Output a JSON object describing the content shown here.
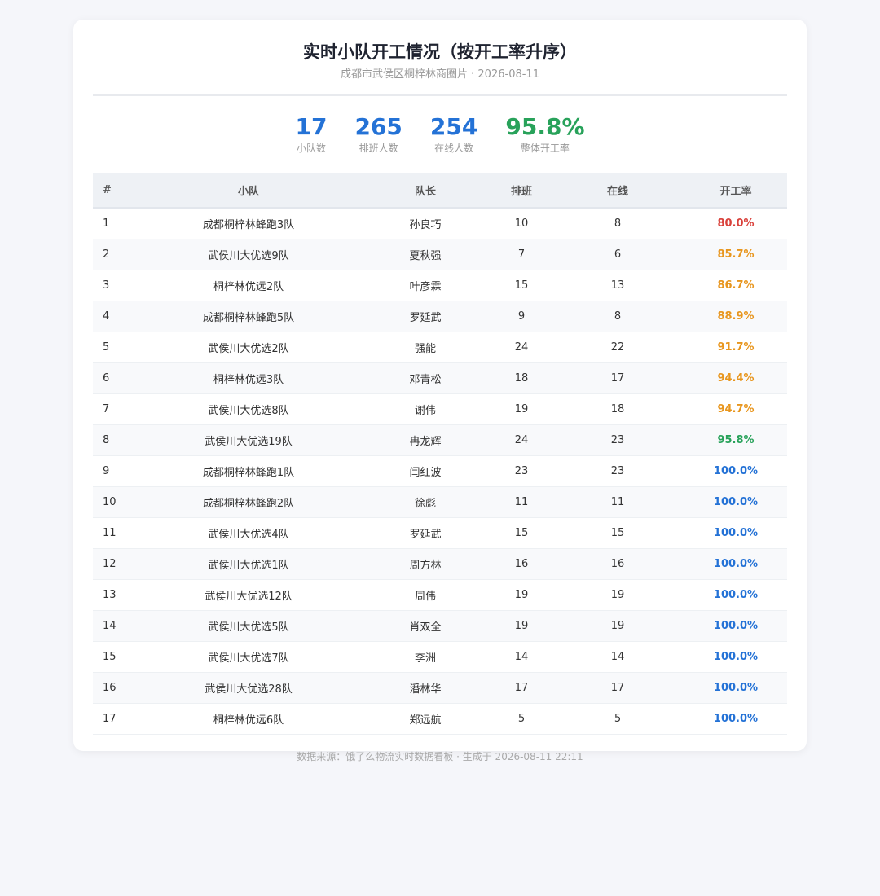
{
  "header": {
    "title": "实时小队开工情况（按开工率升序）",
    "subtitle": "成都市武侯区桐梓林商圈片 · 2026-08-11"
  },
  "stats": [
    {
      "value": "17",
      "label": "小队数",
      "color": "#2472d6"
    },
    {
      "value": "265",
      "label": "排班人数",
      "color": "#2472d6"
    },
    {
      "value": "254",
      "label": "在线人数",
      "color": "#2472d6"
    },
    {
      "value": "95.8%",
      "label": "整体开工率",
      "color": "#28a25a"
    }
  ],
  "table": {
    "headers": [
      "#",
      "小队",
      "队长",
      "排班",
      "在线",
      "开工率"
    ],
    "rows": [
      {
        "idx": "1",
        "team": "成都桐梓林蜂跑3队",
        "leader": "孙良巧",
        "scheduled": "10",
        "online": "8",
        "rate": "80.0%",
        "rate_color": "#d9413b"
      },
      {
        "idx": "2",
        "team": "武侯川大优选9队",
        "leader": "夏秋强",
        "scheduled": "7",
        "online": "6",
        "rate": "85.7%",
        "rate_color": "#e8961e"
      },
      {
        "idx": "3",
        "team": "桐梓林优远2队",
        "leader": "叶彦霖",
        "scheduled": "15",
        "online": "13",
        "rate": "86.7%",
        "rate_color": "#e8961e"
      },
      {
        "idx": "4",
        "team": "成都桐梓林蜂跑5队",
        "leader": "罗延武",
        "scheduled": "9",
        "online": "8",
        "rate": "88.9%",
        "rate_color": "#e8961e"
      },
      {
        "idx": "5",
        "team": "武侯川大优选2队",
        "leader": "强能",
        "scheduled": "24",
        "online": "22",
        "rate": "91.7%",
        "rate_color": "#e8961e"
      },
      {
        "idx": "6",
        "team": "桐梓林优远3队",
        "leader": "邓青松",
        "scheduled": "18",
        "online": "17",
        "rate": "94.4%",
        "rate_color": "#e8961e"
      },
      {
        "idx": "7",
        "team": "武侯川大优选8队",
        "leader": "谢伟",
        "scheduled": "19",
        "online": "18",
        "rate": "94.7%",
        "rate_color": "#e8961e"
      },
      {
        "idx": "8",
        "team": "武侯川大优选19队",
        "leader": "冉龙辉",
        "scheduled": "24",
        "online": "23",
        "rate": "95.8%",
        "rate_color": "#28a25a"
      },
      {
        "idx": "9",
        "team": "成都桐梓林蜂跑1队",
        "leader": "闫红波",
        "scheduled": "23",
        "online": "23",
        "rate": "100.0%",
        "rate_color": "#2472d6"
      },
      {
        "idx": "10",
        "team": "成都桐梓林蜂跑2队",
        "leader": "徐彪",
        "scheduled": "11",
        "online": "11",
        "rate": "100.0%",
        "rate_color": "#2472d6"
      },
      {
        "idx": "11",
        "team": "武侯川大优选4队",
        "leader": "罗延武",
        "scheduled": "15",
        "online": "15",
        "rate": "100.0%",
        "rate_color": "#2472d6"
      },
      {
        "idx": "12",
        "team": "武侯川大优选1队",
        "leader": "周方林",
        "scheduled": "16",
        "online": "16",
        "rate": "100.0%",
        "rate_color": "#2472d6"
      },
      {
        "idx": "13",
        "team": "武侯川大优选12队",
        "leader": "周伟",
        "scheduled": "19",
        "online": "19",
        "rate": "100.0%",
        "rate_color": "#2472d6"
      },
      {
        "idx": "14",
        "team": "武侯川大优选5队",
        "leader": "肖双全",
        "scheduled": "19",
        "online": "19",
        "rate": "100.0%",
        "rate_color": "#2472d6"
      },
      {
        "idx": "15",
        "team": "武侯川大优选7队",
        "leader": "李洲",
        "scheduled": "14",
        "online": "14",
        "rate": "100.0%",
        "rate_color": "#2472d6"
      },
      {
        "idx": "16",
        "team": "武侯川大优选28队",
        "leader": "潘林华",
        "scheduled": "17",
        "online": "17",
        "rate": "100.0%",
        "rate_color": "#2472d6"
      },
      {
        "idx": "17",
        "team": "桐梓林优远6队",
        "leader": "郑远航",
        "scheduled": "5",
        "online": "5",
        "rate": "100.0%",
        "rate_color": "#2472d6"
      }
    ]
  },
  "footer": {
    "text": "数据来源：饿了么物流实时数据看板 · 生成于 2026-08-11 22:11"
  }
}
